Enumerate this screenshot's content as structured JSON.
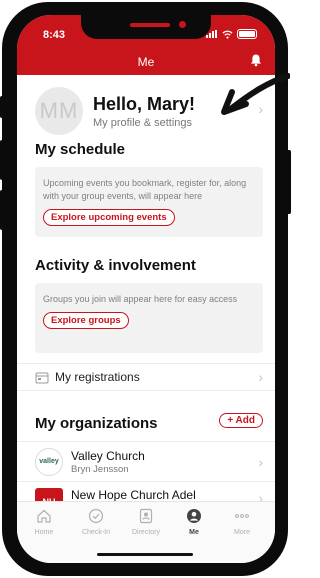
{
  "status": {
    "time": "8:43"
  },
  "header": {
    "title": "Me"
  },
  "profile": {
    "initials": "MM",
    "greeting": "Hello, Mary!",
    "subtitle": "My profile & settings"
  },
  "schedule": {
    "title": "My schedule",
    "text": "Upcoming events you bookmark, register for, along with your group events, will appear here",
    "button": "Explore upcoming events"
  },
  "activity": {
    "title": "Activity & involvement",
    "text": "Groups you join will appear here for easy access",
    "button": "Explore groups"
  },
  "registrations": {
    "label": "My registrations"
  },
  "organizations": {
    "title": "My organizations",
    "add_label": "+ Add",
    "items": [
      {
        "name": "Valley Church",
        "sub": "Bryn Jensson",
        "logo_text": "valley"
      },
      {
        "name": "New Hope Church Adel",
        "sub": "",
        "logo_text": "NH"
      }
    ]
  },
  "tabbar": {
    "tabs": [
      {
        "label": "Home",
        "icon": "home-icon"
      },
      {
        "label": "Check-In",
        "icon": "check-circle-icon"
      },
      {
        "label": "Directory",
        "icon": "directory-icon"
      },
      {
        "label": "Me",
        "icon": "person-icon",
        "active": true
      },
      {
        "label": "More",
        "icon": "more-dots-icon"
      }
    ]
  },
  "colors": {
    "brand": "#c8151b",
    "card_bg": "#f2f2f2"
  }
}
